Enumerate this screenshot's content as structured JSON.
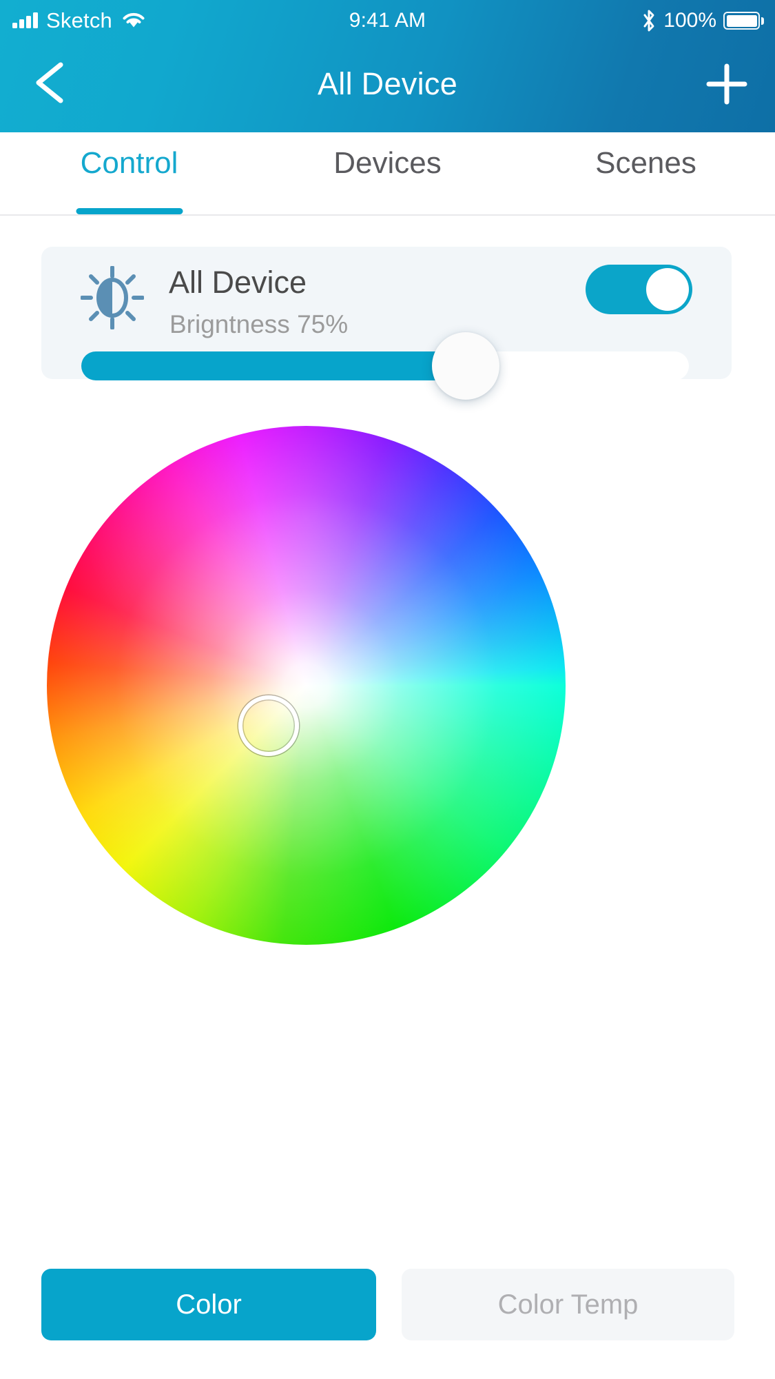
{
  "status_bar": {
    "carrier": "Sketch",
    "time": "9:41 AM",
    "battery_percent": "100%",
    "icons": [
      "signal-bars-icon",
      "wifi-icon",
      "bluetooth-icon",
      "battery-icon"
    ]
  },
  "header": {
    "title": "All Device",
    "back_icon": "chevron-left-icon",
    "add_icon": "plus-icon",
    "gradient_from": "#12AED0",
    "gradient_to": "#0E6FA6"
  },
  "tabs": [
    {
      "label": "Control",
      "active": true
    },
    {
      "label": "Devices",
      "active": false
    },
    {
      "label": "Scenes",
      "active": false
    }
  ],
  "brightness_card": {
    "icon": "brightness-sun-icon",
    "device_name": "All Device",
    "brightness_text": "Brigntness 75%",
    "brightness_value": 75,
    "power_on": true,
    "accent_color": "#07A4CB",
    "card_background": "#F2F6F9"
  },
  "color_picker": {
    "type": "hsv-color-wheel",
    "handle_label": "color-selection-handle",
    "selected_hue_region": "light blue"
  },
  "mode_buttons": [
    {
      "label": "Color",
      "active": true
    },
    {
      "label": "Color Temp",
      "active": false
    }
  ]
}
